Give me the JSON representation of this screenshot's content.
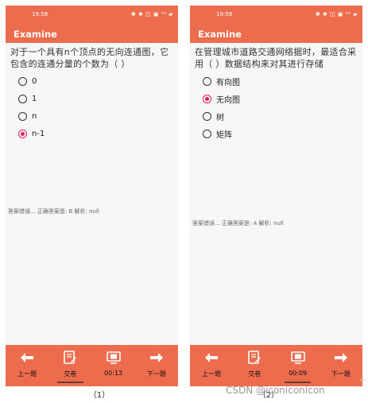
{
  "panels": [
    {
      "status_time": "19:58",
      "status_icons": "✱ ✱ ◫ ▣ ⁴⁶ ▰",
      "app_title": "Examine",
      "question": "对于一个具有n个顶点的无向连通图，它包含的连通分量的个数为（   ）",
      "options": [
        {
          "label": "0",
          "checked": false
        },
        {
          "label": "1",
          "checked": false
        },
        {
          "label": "n",
          "checked": false
        },
        {
          "label": "n-1",
          "checked": true
        }
      ],
      "feedback": "答案错误...  正确答案是: B  解析: null",
      "nav": {
        "prev": "上一题",
        "submit": "交卷",
        "timer": "00:13",
        "next": "下一题"
      },
      "caption": "（1）"
    },
    {
      "status_time": "19:58",
      "status_icons": "✱ ✱ ◫ ▣ ⁴⁶ ▰",
      "app_title": "Examine",
      "question": "  在管理城市道路交通网络据时，最适合采用（   ）数据结构来对其进行存储",
      "options": [
        {
          "label": "有向图",
          "checked": false
        },
        {
          "label": "无向图",
          "checked": true
        },
        {
          "label": "树",
          "checked": false
        },
        {
          "label": "矩阵",
          "checked": false
        }
      ],
      "feedback": "答案错误...  正确答案是: A  解析: null",
      "nav": {
        "prev": "上一题",
        "submit": "交卷",
        "timer": "00:09",
        "next": "下一题"
      },
      "caption": "（2）"
    }
  ],
  "watermark": "CSDN @iconiconicon",
  "colors": {
    "accent": "#ee6c4e",
    "radio_checked": "#e91e63"
  }
}
